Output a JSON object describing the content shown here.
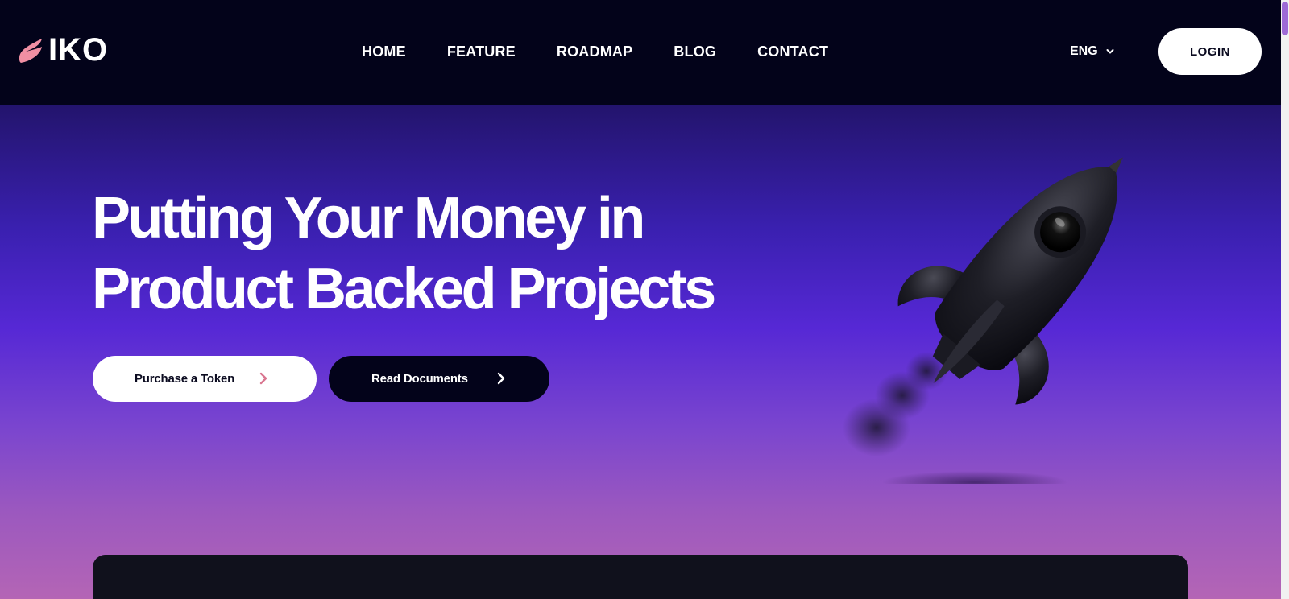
{
  "brand": {
    "logo_text": "IKO",
    "accent": "#f08fa3"
  },
  "nav": {
    "items": [
      {
        "label": "HOME"
      },
      {
        "label": "FEATURE"
      },
      {
        "label": "ROADMAP"
      },
      {
        "label": "BLOG"
      },
      {
        "label": "CONTACT"
      }
    ]
  },
  "lang": {
    "label": "ENG",
    "icon": "chevron-down-icon"
  },
  "login": {
    "label": "LOGIN"
  },
  "hero": {
    "title_line1": "Putting Your Money in",
    "title_line2": "Product Backed Projects",
    "primary_button": {
      "label": "Purchase a Token",
      "icon": "chevron-right-icon",
      "icon_color": "#d9758f"
    },
    "secondary_button": {
      "label": "Read Documents",
      "icon": "chevron-right-icon"
    },
    "illustration": "rocket"
  },
  "colors": {
    "header_bg": "#03031a",
    "gradient_top": "#23146d",
    "gradient_mid": "#5628d5",
    "gradient_bottom": "#b465b5",
    "card_bg": "#10111c",
    "scroll_thumb": "#9d6ad6"
  }
}
